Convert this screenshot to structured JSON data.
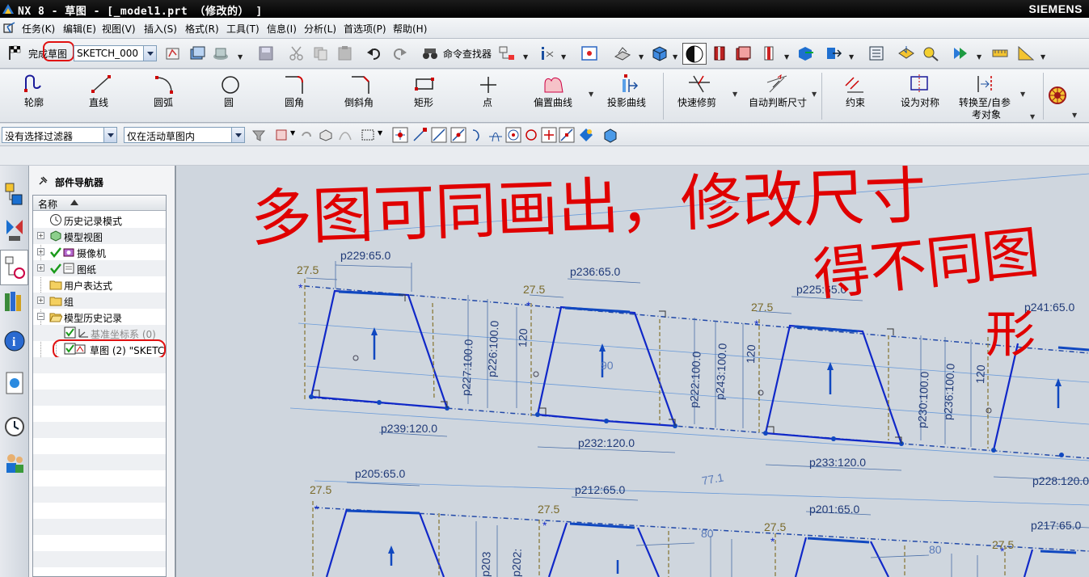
{
  "window": {
    "title": "NX 8 - 草图 - [_model1.prt （修改的） ]",
    "brand": "SIEMENS"
  },
  "menubar": {
    "items": [
      "任务(K)",
      "编辑(E)",
      "视图(V)",
      "插入(S)",
      "格式(R)",
      "工具(T)",
      "信息(I)",
      "分析(L)",
      "首选项(P)",
      "帮助(H)"
    ]
  },
  "toolbar": {
    "finish_sketch_label": "完成草图",
    "sketch_name": "SKETCH_000",
    "command_finder_label": "命令查找器"
  },
  "sketch_ribbon": {
    "items": [
      {
        "label": "轮廓",
        "icon": "profile-icon"
      },
      {
        "label": "直线",
        "icon": "line-icon"
      },
      {
        "label": "圆弧",
        "icon": "arc-icon"
      },
      {
        "label": "圆",
        "icon": "circle-icon"
      },
      {
        "label": "圆角",
        "icon": "fillet-icon"
      },
      {
        "label": "倒斜角",
        "icon": "chamfer-icon"
      },
      {
        "label": "矩形",
        "icon": "rectangle-icon"
      },
      {
        "label": "点",
        "icon": "point-icon"
      },
      {
        "label": "偏置曲线",
        "icon": "offset-curve-icon"
      },
      {
        "label": "投影曲线",
        "icon": "project-curve-icon"
      },
      {
        "label": "快速修剪",
        "icon": "quick-trim-icon"
      },
      {
        "label": "自动判断尺寸",
        "icon": "inferred-dimension-icon"
      },
      {
        "label": "约束",
        "icon": "constraint-icon"
      },
      {
        "label": "设为对称",
        "icon": "make-symmetric-icon"
      },
      {
        "label": "转换至/自参",
        "label2": "考对象",
        "icon": "convert-reference-icon"
      }
    ]
  },
  "filterbar": {
    "type_filter": "没有选择过滤器",
    "scope_filter": "仅在活动草图内"
  },
  "navigator": {
    "title": "部件导航器",
    "column_header": "名称",
    "rows": [
      {
        "label": "历史记录模式",
        "icon": "clock-icon"
      },
      {
        "label": "模型视图",
        "icon": "model-views-icon"
      },
      {
        "label": "摄像机",
        "icon": "camera-icon"
      },
      {
        "label": "图纸",
        "icon": "drawing-sheet-icon"
      },
      {
        "label": "用户表达式",
        "icon": "folder-icon"
      },
      {
        "label": "组",
        "icon": "folder-icon"
      },
      {
        "label": "模型历史记录",
        "icon": "folder-open-icon"
      },
      {
        "label": "基准坐标系 (0)",
        "icon": "datum-csys-icon"
      },
      {
        "label": "草图 (2) \"SKETC",
        "icon": "sketch-feature-icon"
      }
    ]
  },
  "annotation": {
    "line1": "多图可同画出，修改尺寸",
    "line2": "得不同图",
    "line3": "形"
  },
  "sketch": {
    "dimensions": [
      {
        "text": "27.5"
      },
      {
        "text": "p229:65.0"
      },
      {
        "text": "p227:100.0"
      },
      {
        "text": "p226:100.0"
      },
      {
        "text": "p239:120.0"
      },
      {
        "text": "120"
      },
      {
        "text": "27.5"
      },
      {
        "text": "p236:65.0"
      },
      {
        "text": "p222:100.0"
      },
      {
        "text": "p243:100.0"
      },
      {
        "text": "p232:120.0"
      },
      {
        "text": "120"
      },
      {
        "text": "27.5"
      },
      {
        "text": "p225:65.0"
      },
      {
        "text": "p230:100.0"
      },
      {
        "text": "p236:100.0"
      },
      {
        "text": "p233:120.0"
      },
      {
        "text": "120"
      },
      {
        "text": "p241:65.0"
      },
      {
        "text": "p228:120.0"
      },
      {
        "text": "27.5"
      },
      {
        "text": "p205:65.0"
      },
      {
        "text": "p203"
      },
      {
        "text": "p202:"
      },
      {
        "text": "27.5"
      },
      {
        "text": "p212:65.0"
      },
      {
        "text": "27.5"
      },
      {
        "text": "p201:65.0"
      },
      {
        "text": "27.5"
      },
      {
        "text": "p217:65.0"
      },
      {
        "text": "90"
      },
      {
        "text": "77.1"
      },
      {
        "text": "80"
      },
      {
        "text": "80"
      }
    ]
  }
}
